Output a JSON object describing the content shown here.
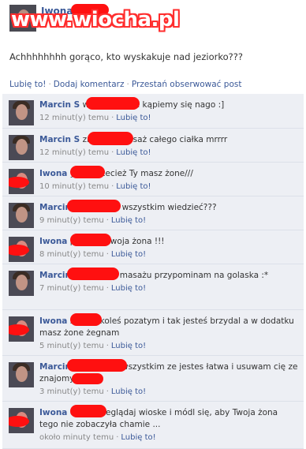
{
  "post": {
    "author": "Iwona",
    "status": "Achhhhhhhh gorąco, kto wyskakuje nad jeziorko???"
  },
  "watermark": "www.wiocha.pl",
  "actions": {
    "like": "Lubię to!",
    "comment": "Dodaj komentarz",
    "unfollow": "Przestań obserwować post"
  },
  "comments": [
    {
      "author": "Marcin S",
      "text": "wyskocze, ale kąpiemy się nago :]",
      "time": "12 minut(y) temu",
      "like": "Lubię to!"
    },
    {
      "author": "Marcin S",
      "text": "zrobię ci masaż całego ciałka mrrrr",
      "time": "12 minut(y) temu",
      "like": "Lubię to!"
    },
    {
      "author": "Iwona",
      "text": "yyyy przecież Ty masz żone///",
      "time": "10 minut(y) temu",
      "like": "Lubię to!"
    },
    {
      "author": "Marcin",
      "text": "ona musi o wszystkim wiedzieć???",
      "time": "9 minut(y) temu",
      "like": "Lubię to!"
    },
    {
      "author": "Iwona",
      "text": "przecież twoja żona !!!",
      "time": "8 minut(y) temu",
      "like": "Lubię to!"
    },
    {
      "author": "Marcin",
      "text": "nie chcesz masażu przypominam na golaska :*",
      "time": "7 minut(y) temu",
      "like": "Lubię to!"
    },
    {
      "author": "Iwona",
      "text": "spadaj koleś pozatym i tak jesteś brzydal a w dodatku masz żone żegnam",
      "time": "5 minut(y) temu",
      "like": "Lubię to!"
    },
    {
      "author": "Marcin",
      "text": "rozpowiem wszystkim ze jestes łatwa i usuwam cię ze znajomych !",
      "time": "3 minut(y) temu",
      "like": "Lubię to!"
    },
    {
      "author": "Iwona",
      "text": "epiej przeglądaj wioske i módl się, aby Twoja żona tego nie zobaczyła chamie ...",
      "time": "około minuty temu",
      "like": "Lubię to!"
    }
  ],
  "colors": {
    "link": "#3b5998",
    "comment_bg": "#edeff4",
    "redaction": "#ff1010",
    "watermark": "#ff2d2d"
  }
}
